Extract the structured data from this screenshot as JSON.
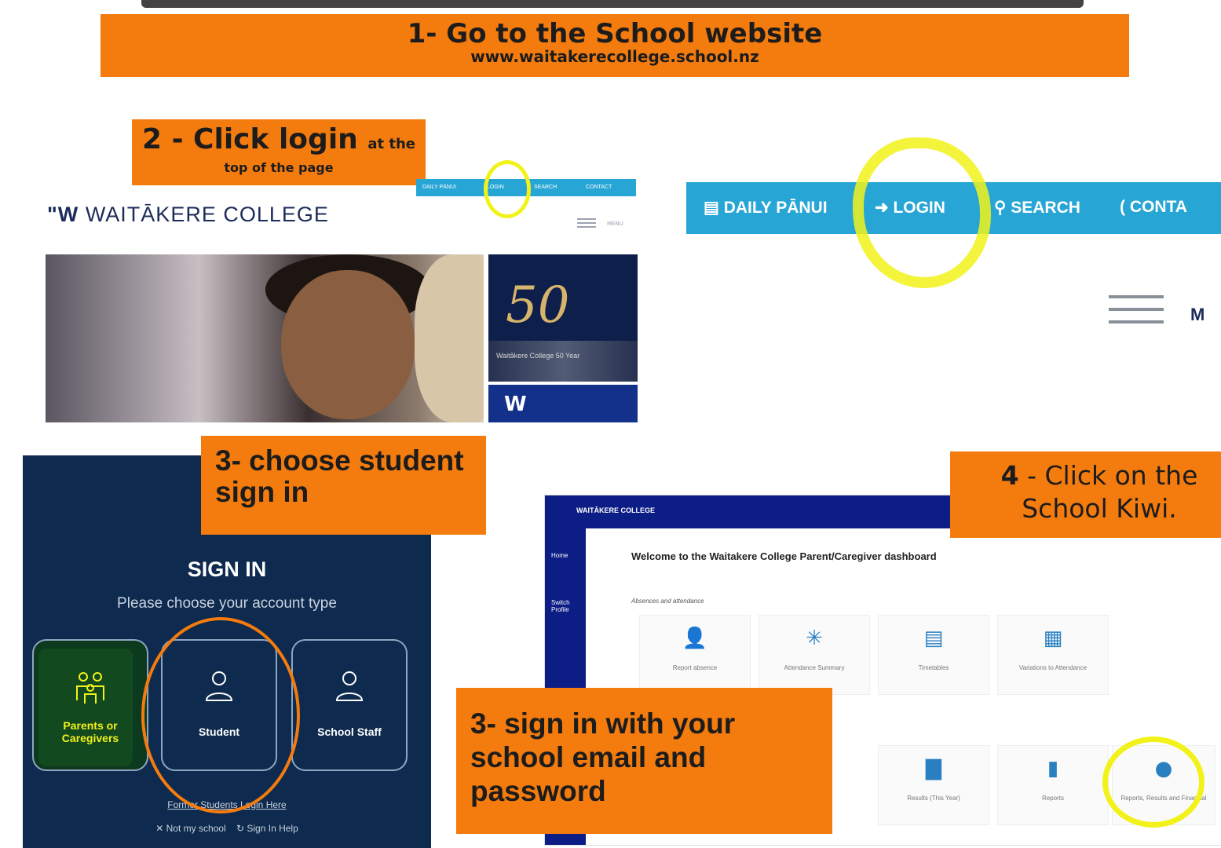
{
  "step1": {
    "title": "1- Go to the School website",
    "url": "www.waitakerecollege.school.nz"
  },
  "step2": {
    "title": "2 - Click login",
    "title_small": "at the",
    "subtitle": "top of the page"
  },
  "mini_site": {
    "bar": [
      "DAILY PĀNUI",
      "LOGIN",
      "SEARCH",
      "CONTACT"
    ],
    "logo": "WAITĀKERE COLLEGE",
    "menu_label": "MENU",
    "tile_number": "50",
    "tile_caption": "Waitākere College 50 Year"
  },
  "zoom_bar": {
    "items": [
      {
        "label": "DAILY PĀNUI",
        "icon": "newspaper-icon"
      },
      {
        "label": "LOGIN",
        "icon": "login-icon"
      },
      {
        "label": "SEARCH",
        "icon": "search-icon"
      },
      {
        "label": "CONTA",
        "icon": "phone-icon"
      }
    ],
    "menu_label": "M"
  },
  "step3a": {
    "text": "3- choose student sign in"
  },
  "signin": {
    "heading": "SIGN IN",
    "subheading": "Please choose your account type",
    "cards": [
      {
        "label": "Parents or Caregivers",
        "icon": "family-icon"
      },
      {
        "label": "Student",
        "icon": "person-icon"
      },
      {
        "label": "School Staff",
        "icon": "staff-icon"
      }
    ],
    "former_link": "Former Students Login Here",
    "not_my_school": "✕ Not my school",
    "help": "Sign In Help"
  },
  "step4": {
    "line1_num": "4",
    "line1": "- Click on the",
    "line2": "School Kiwi."
  },
  "dashboard": {
    "brand": "WAITĀKERE COLLEGE",
    "side": [
      "Home",
      "Switch Profile"
    ],
    "welcome": "Welcome to the Waitakere College Parent/Caregiver dashboard",
    "section": "Absences and attendance",
    "tiles_row1": [
      "Report absence",
      "Attendance Summary",
      "Timetables",
      "Variations to Attendance"
    ],
    "tiles_row2": [
      "Results (This Year)",
      "Reports",
      "Reports, Results and Financial"
    ]
  },
  "step3b": {
    "text": "3- sign in with your school email and password"
  }
}
